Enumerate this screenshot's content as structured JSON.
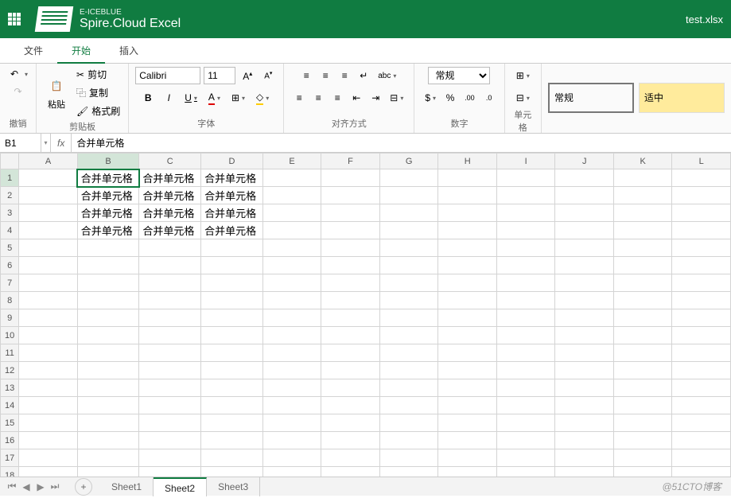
{
  "brand": {
    "sub": "E-ICEBLUE",
    "main": "Spire.Cloud Excel"
  },
  "filename": "test.xlsx",
  "menu": {
    "file": "文件",
    "home": "开始",
    "insert": "插入"
  },
  "ribbon": {
    "undo": {
      "undo": "撤销"
    },
    "clipboard": {
      "paste": "粘贴",
      "cut": "剪切",
      "copy": "复制",
      "format_painter": "格式刷",
      "label": "剪贴板"
    },
    "font": {
      "name": "Calibri",
      "size": "11",
      "bold": "B",
      "italic": "I",
      "underline": "U",
      "label": "字体"
    },
    "align": {
      "label": "对齐方式",
      "abc": "abc"
    },
    "number": {
      "format": "常规",
      "percent": "%",
      "label": "数字",
      "dollar": "$"
    },
    "cell": {
      "label": "单元格"
    },
    "styles": {
      "normal": "常规",
      "neutral": "适中"
    }
  },
  "formula_bar": {
    "cell_ref": "B1",
    "fx": "fx",
    "value": "合并单元格"
  },
  "grid": {
    "columns": [
      "A",
      "B",
      "C",
      "D",
      "E",
      "F",
      "G",
      "H",
      "I",
      "J",
      "K",
      "L"
    ],
    "row_count": 19,
    "selected": {
      "col": "B",
      "row": 1
    },
    "cells": {
      "B1": "合并单元格",
      "C1": "合并单元格",
      "D1": "合并单元格",
      "B2": "合并单元格",
      "C2": "合并单元格",
      "D2": "合并单元格",
      "B3": "合并单元格",
      "C3": "合并单元格",
      "D3": "合并单元格",
      "B4": "合并单元格",
      "C4": "合并单元格",
      "D4": "合并单元格"
    }
  },
  "sheets": {
    "list": [
      "Sheet1",
      "Sheet2",
      "Sheet3"
    ],
    "active": "Sheet2"
  },
  "watermark": "@51CTO博客"
}
